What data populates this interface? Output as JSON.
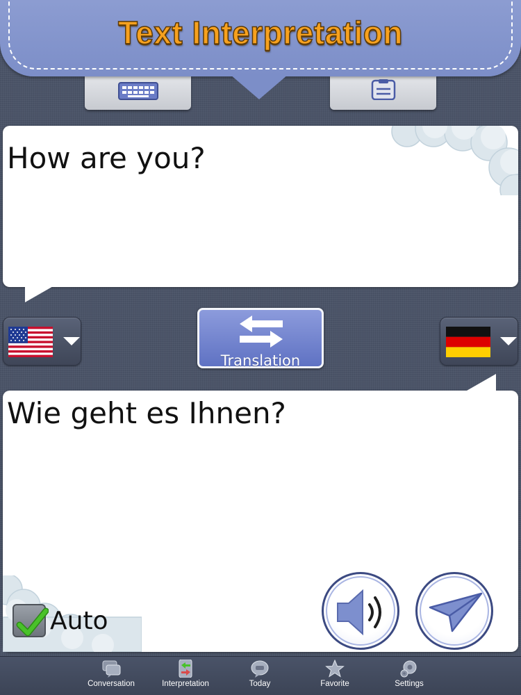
{
  "header": {
    "title": "Text Interpretation"
  },
  "input_modes": [
    {
      "icon": "keyboard-icon"
    },
    {
      "icon": "clipboard-icon"
    }
  ],
  "source": {
    "text": "How are you?",
    "language_flag": "us-flag-icon"
  },
  "target": {
    "text": "Wie geht es Ihnen?",
    "language_flag": "germany-flag-icon"
  },
  "swap": {
    "label": "Translation",
    "icon": "swap-arrows-icon"
  },
  "auto": {
    "label": "Auto",
    "checked": true
  },
  "actions": [
    {
      "icon": "speaker-icon"
    },
    {
      "icon": "send-icon"
    }
  ],
  "tabbar": {
    "items": [
      {
        "label": "Conversation",
        "icon": "conversation-icon"
      },
      {
        "label": "Interpretation",
        "icon": "interpretation-icon"
      },
      {
        "label": "Today",
        "icon": "today-icon"
      },
      {
        "label": "Favorite",
        "icon": "favorite-icon"
      },
      {
        "label": "Settings",
        "icon": "settings-icon"
      }
    ]
  },
  "colors": {
    "header": "#7c8ec8",
    "title": "#f7a11e",
    "background": "#4b5468",
    "accent": "#5f72c3",
    "check": "#3cb021"
  }
}
